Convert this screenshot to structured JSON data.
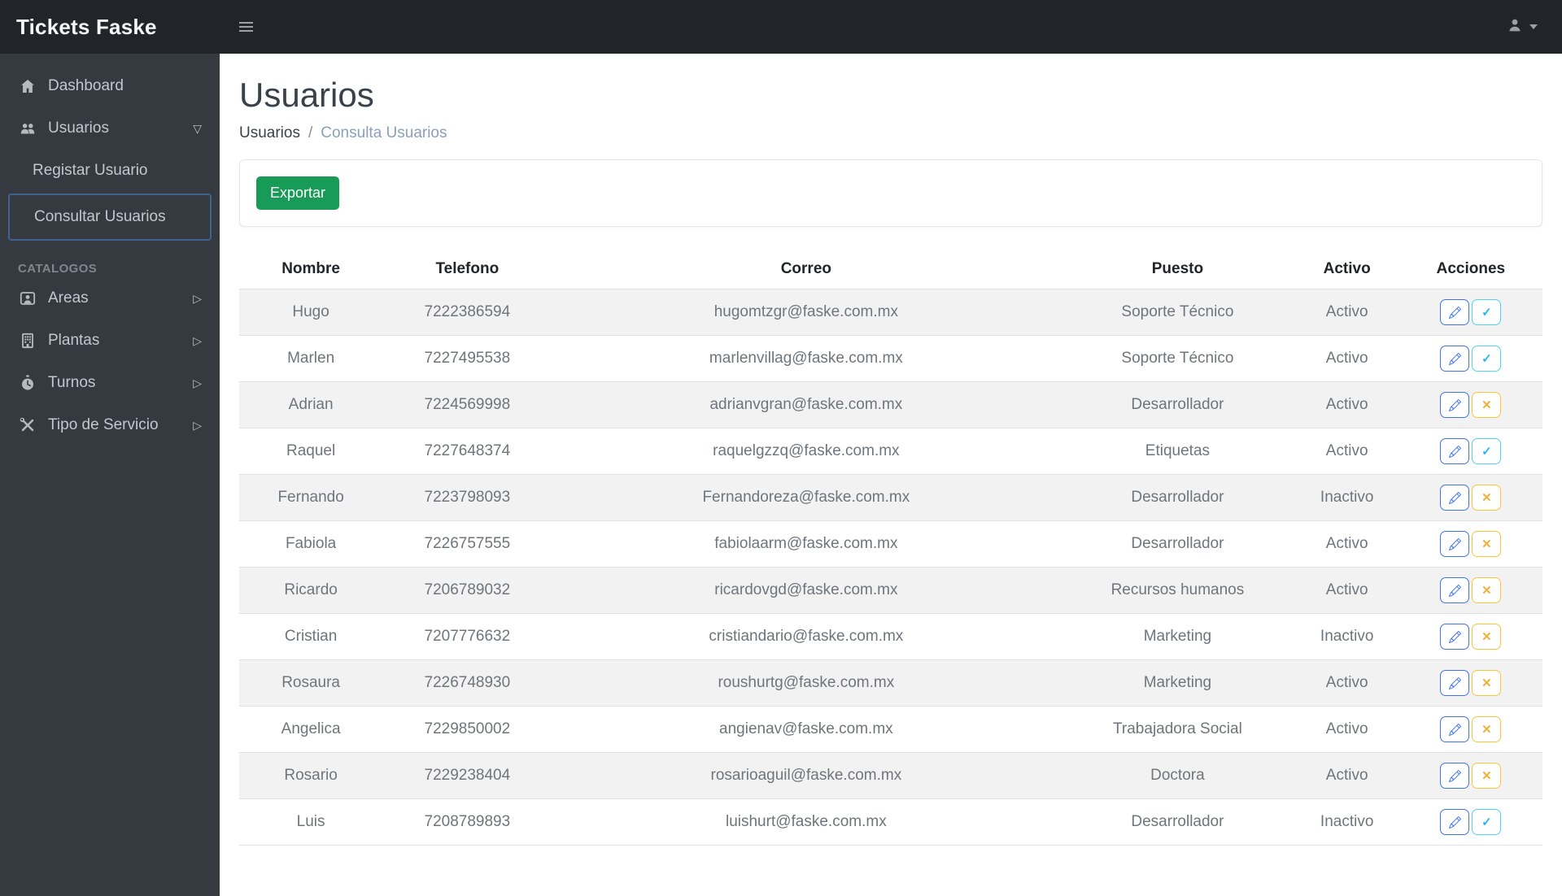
{
  "navbar": {
    "brand": "Tickets Faske"
  },
  "sidebar": {
    "items": [
      {
        "label": "Dashboard",
        "icon": "home-icon"
      },
      {
        "label": "Usuarios",
        "icon": "users-icon",
        "expanded": true,
        "children": [
          {
            "label": "Registar Usuario"
          },
          {
            "label": "Consultar Usuarios",
            "selected": true
          }
        ]
      }
    ],
    "section_label": "CATALOGOS",
    "catalogs": [
      {
        "label": "Areas",
        "icon": "person-card-icon"
      },
      {
        "label": "Plantas",
        "icon": "building-icon"
      },
      {
        "label": "Turnos",
        "icon": "stopwatch-icon"
      },
      {
        "label": "Tipo de Servicio",
        "icon": "tools-icon"
      }
    ]
  },
  "main": {
    "title": "Usuarios",
    "breadcrumb": {
      "items": [
        {
          "label": "Usuarios"
        },
        {
          "label": "Consulta Usuarios",
          "active": true
        }
      ],
      "separator": "/"
    },
    "export_button": "Exportar",
    "table": {
      "headers": [
        "Nombre",
        "Telefono",
        "Correo",
        "Puesto",
        "Activo",
        "Acciones"
      ],
      "rows": [
        {
          "name": "Hugo",
          "phone": "7222386594",
          "email": "hugomtzgr@faske.com.mx",
          "role": "Soporte Técnico",
          "status": "Activo",
          "action": "check"
        },
        {
          "name": "Marlen",
          "phone": "7227495538",
          "email": "marlenvillag@faske.com.mx",
          "role": "Soporte Técnico",
          "status": "Activo",
          "action": "check"
        },
        {
          "name": "Adrian",
          "phone": "7224569998",
          "email": "adrianvgran@faske.com.mx",
          "role": "Desarrollador",
          "status": "Activo",
          "action": "x"
        },
        {
          "name": "Raquel",
          "phone": "7227648374",
          "email": "raquelgzzq@faske.com.mx",
          "role": "Etiquetas",
          "status": "Activo",
          "action": "check"
        },
        {
          "name": "Fernando",
          "phone": "7223798093",
          "email": "Fernandoreza@faske.com.mx",
          "role": "Desarrollador",
          "status": "Inactivo",
          "action": "x"
        },
        {
          "name": "Fabiola",
          "phone": "7226757555",
          "email": "fabiolaarm@faske.com.mx",
          "role": "Desarrollador",
          "status": "Activo",
          "action": "x"
        },
        {
          "name": "Ricardo",
          "phone": "7206789032",
          "email": "ricardovgd@faske.com.mx",
          "role": "Recursos humanos",
          "status": "Activo",
          "action": "x"
        },
        {
          "name": "Cristian",
          "phone": "7207776632",
          "email": "cristiandario@faske.com.mx",
          "role": "Marketing",
          "status": "Inactivo",
          "action": "x"
        },
        {
          "name": "Rosaura",
          "phone": "7226748930",
          "email": "roushurtg@faske.com.mx",
          "role": "Marketing",
          "status": "Activo",
          "action": "x"
        },
        {
          "name": "Angelica",
          "phone": "7229850002",
          "email": "angienav@faske.com.mx",
          "role": "Trabajadora Social",
          "status": "Activo",
          "action": "x"
        },
        {
          "name": "Rosario",
          "phone": "7229238404",
          "email": "rosarioaguil@faske.com.mx",
          "role": "Doctora",
          "status": "Activo",
          "action": "x"
        },
        {
          "name": "Luis",
          "phone": "7208789893",
          "email": "luishurt@faske.com.mx",
          "role": "Desarrollador",
          "status": "Inactivo",
          "action": "check"
        }
      ]
    }
  },
  "icons": {
    "caret_expanded": "▽",
    "caret_collapsed": "▷",
    "check": "✓",
    "x": "✕"
  },
  "colors": {
    "navbar_bg": "#212529",
    "sidebar_bg": "#343a40",
    "export_green": "#199b58",
    "edit_blue": "#3d73f0",
    "check_cyan": "#29b7ef",
    "warning_amber": "#efb23c",
    "focus_border": "#41628e",
    "stripe_gray": "#f2f2f2",
    "breadcrumb_active": "#8ba0b9"
  }
}
